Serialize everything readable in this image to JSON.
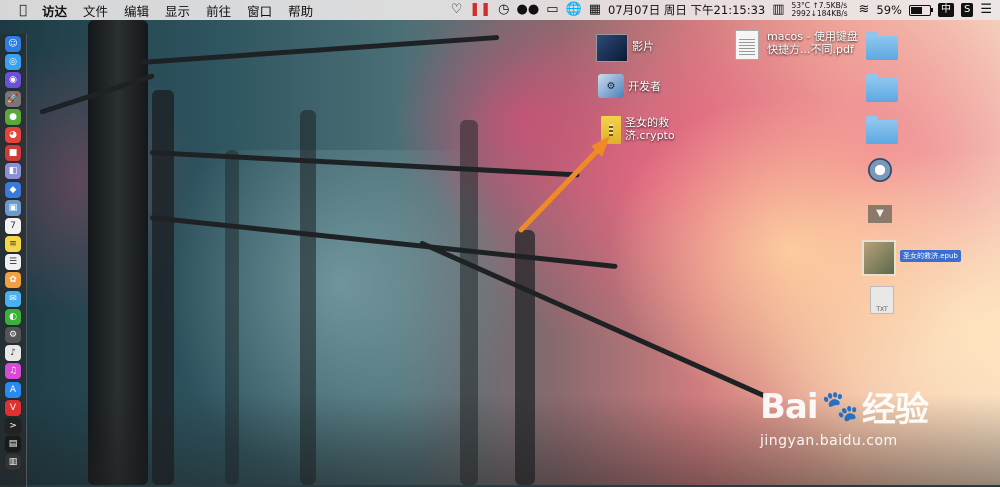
{
  "menubar": {
    "apple_icon": "apple-icon",
    "items": [
      "访达",
      "文件",
      "编辑",
      "显示",
      "前往",
      "窗口",
      "帮助"
    ],
    "status": {
      "date_time": "07月07日 周日 下午21:15:33",
      "temp": "53°C",
      "fan": "2992",
      "net_up": "↑7.5KB/s",
      "net_down": "↓184KB/s",
      "battery": "59%",
      "battery_level": 59,
      "input_source": "中",
      "logo_s": "S"
    }
  },
  "dock": {
    "apps": [
      {
        "name": "finder-icon",
        "color": "#2f7de0",
        "glyph": "☺"
      },
      {
        "name": "safari-icon",
        "color": "#3aa0f0",
        "glyph": "◎"
      },
      {
        "name": "siri-icon",
        "color": "#6a4fd8",
        "glyph": "◉"
      },
      {
        "name": "launchpad-icon",
        "color": "#777777",
        "glyph": "🚀"
      },
      {
        "name": "android-icon",
        "color": "#5aa83a",
        "glyph": "●"
      },
      {
        "name": "chrome-icon",
        "color": "#e0443a",
        "glyph": "◕"
      },
      {
        "name": "app-red-icon",
        "color": "#cf3a3a",
        "glyph": "■"
      },
      {
        "name": "disk-icon",
        "color": "#8a8fd8",
        "glyph": "◧"
      },
      {
        "name": "app-blue-icon",
        "color": "#3a7ad8",
        "glyph": "◆"
      },
      {
        "name": "preview-icon",
        "color": "#6a9ad0",
        "glyph": "▣"
      },
      {
        "name": "calendar-icon",
        "color": "#f2f2f2",
        "glyph": "7"
      },
      {
        "name": "notes-icon",
        "color": "#f5d64a",
        "glyph": "≡"
      },
      {
        "name": "reminders-icon",
        "color": "#f0f0f0",
        "glyph": "☰"
      },
      {
        "name": "photos-icon",
        "color": "#f0a040",
        "glyph": "✿"
      },
      {
        "name": "messages-icon",
        "color": "#4ab0f0",
        "glyph": "✉"
      },
      {
        "name": "wechat-icon",
        "color": "#3ab03a",
        "glyph": "◐"
      },
      {
        "name": "app-grey-icon",
        "color": "#555555",
        "glyph": "⚙"
      },
      {
        "name": "music-icon",
        "color": "#e8e8e8",
        "glyph": "♪"
      },
      {
        "name": "itunes-icon",
        "color": "#d84ad8",
        "glyph": "♫"
      },
      {
        "name": "appstore-icon",
        "color": "#2a8af0",
        "glyph": "A"
      },
      {
        "name": "vivaldi-icon",
        "color": "#e03030",
        "glyph": "V"
      },
      {
        "name": "terminal-icon",
        "color": "#222222",
        "glyph": ">"
      },
      {
        "name": "activity-icon",
        "color": "#1a1a1a",
        "glyph": "▤"
      },
      {
        "name": "app-dark-icon",
        "color": "#333333",
        "glyph": "▥"
      }
    ]
  },
  "desktop": {
    "photo_label": "影片",
    "dev_label": "开发者",
    "crypto_label_1": "圣女的救",
    "crypto_label_2": "济.crypto",
    "pdf_label_1": "macos - 使用键盘",
    "pdf_label_2": "快捷方...不同.pdf",
    "selected_label": "圣女的救济.epub",
    "txt_label": "TXT"
  },
  "watermark": {
    "brand": "Bai",
    "brand2": "经验",
    "url": "jingyan.baidu.com"
  },
  "colors": {
    "arrow": "#f08a24",
    "menubar_bg": "#ebe8e8",
    "selection": "#3a6fd0"
  }
}
